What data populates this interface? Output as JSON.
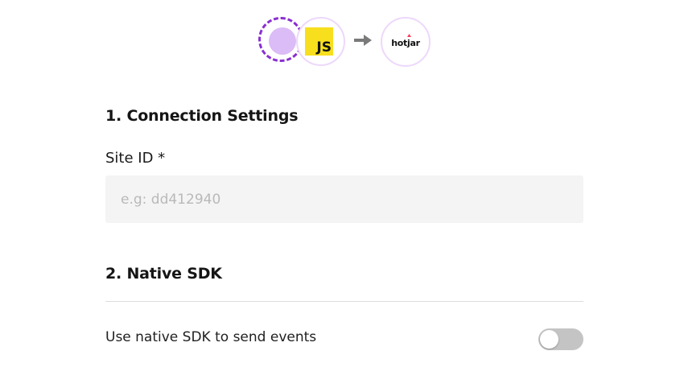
{
  "connection_graphic": {
    "source_icon": "source-placeholder-icon",
    "source_type_icon": "javascript-icon",
    "source_type_label": "JS",
    "arrow_icon": "arrow-right-icon",
    "destination_icon": "hotjar-logo-icon",
    "destination_label": "hotjar",
    "colors": {
      "accent_purple": "#8a2fd0",
      "light_purple": "#dbbcf6",
      "ring": "#edd8fb",
      "js_yellow": "#f7df1e",
      "hotjar_red": "#fd3a5c"
    }
  },
  "section_connection": {
    "title": "1. Connection Settings",
    "site_id": {
      "label": "Site ID *",
      "value": "",
      "placeholder": "e.g: dd412940"
    }
  },
  "section_native_sdk": {
    "title": "2. Native SDK",
    "toggle_label": "Use native SDK to send events",
    "toggle_on": false,
    "toggle_off_color": "#c4c4c4"
  }
}
